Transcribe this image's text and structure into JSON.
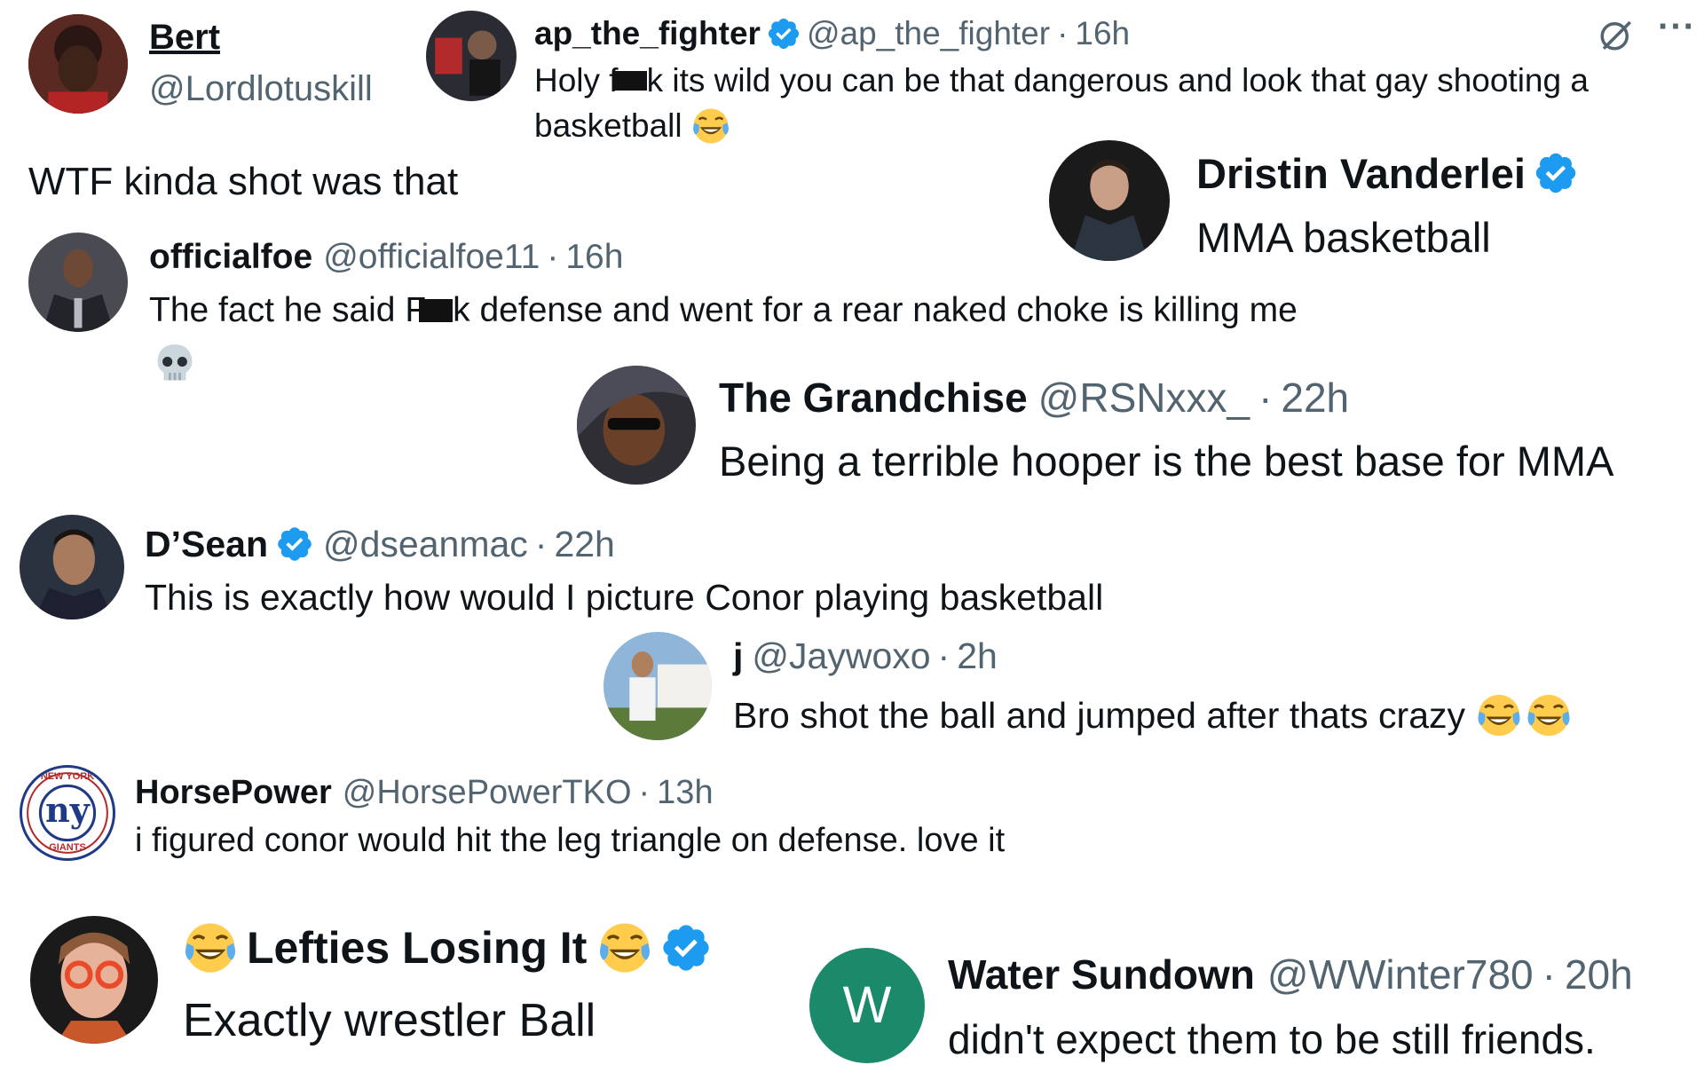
{
  "posts": {
    "bert": {
      "name": "Bert",
      "handle": "@Lordlotuskill",
      "text": "WTF kinda shot was that"
    },
    "ap": {
      "name": "ap_the_fighter",
      "handle": "@ap_the_fighter",
      "sep": "·",
      "time": "16h",
      "text1_a": "Holy f",
      "text1_b": "k its wild you can be that dangerous and look that gay shooting a",
      "text2": "basketball"
    },
    "dristin": {
      "name": "Dristin Vanderlei",
      "text": "MMA basketball"
    },
    "officialfoe": {
      "name": "officialfoe",
      "handle": "@officialfoe11",
      "sep": "·",
      "time": "16h",
      "text_a": "The fact he said F",
      "text_b": "k defense and went for a rear naked choke is killing me"
    },
    "grandchise": {
      "name": "The Grandchise",
      "handle": "@RSNxxx_",
      "sep": "·",
      "time": "22h",
      "text": "Being a terrible hooper is the best base for MMA"
    },
    "dsean": {
      "name": "D’Sean",
      "handle": "@dseanmac",
      "sep": "·",
      "time": "22h",
      "text": "This is exactly how would I picture Conor playing basketball"
    },
    "j": {
      "name": "j",
      "handle": "@Jaywoxo",
      "sep": "·",
      "time": "2h",
      "text": "Bro shot the ball and jumped after thats crazy"
    },
    "horsepower": {
      "name": "HorsePower",
      "handle": "@HorsePowerTKO",
      "sep": "·",
      "time": "13h",
      "text": "i figured conor would hit the leg triangle on defense. love it",
      "avatar_text": "ny",
      "avatar_ring_top": "NEW YORK",
      "avatar_ring_bottom": "GIANTS"
    },
    "lefties": {
      "name": "Lefties Losing It",
      "text": "Exactly wrestler Ball"
    },
    "water": {
      "name": "Water Sundown",
      "handle": "@WWinter780",
      "sep": "·",
      "time": "20h",
      "text": "didn't expect them to be still friends.",
      "avatar_letter": "W"
    }
  },
  "icons": {
    "verified": "verified-badge-icon",
    "grok": "grok-icon",
    "more": "more-icon",
    "laugh": "tears-of-joy-emoji",
    "skull": "skull-emoji"
  },
  "colors": {
    "verified_blue": "#1d9bf0",
    "handle_gray": "#536471",
    "water_avatar": "#1a8a6a"
  }
}
